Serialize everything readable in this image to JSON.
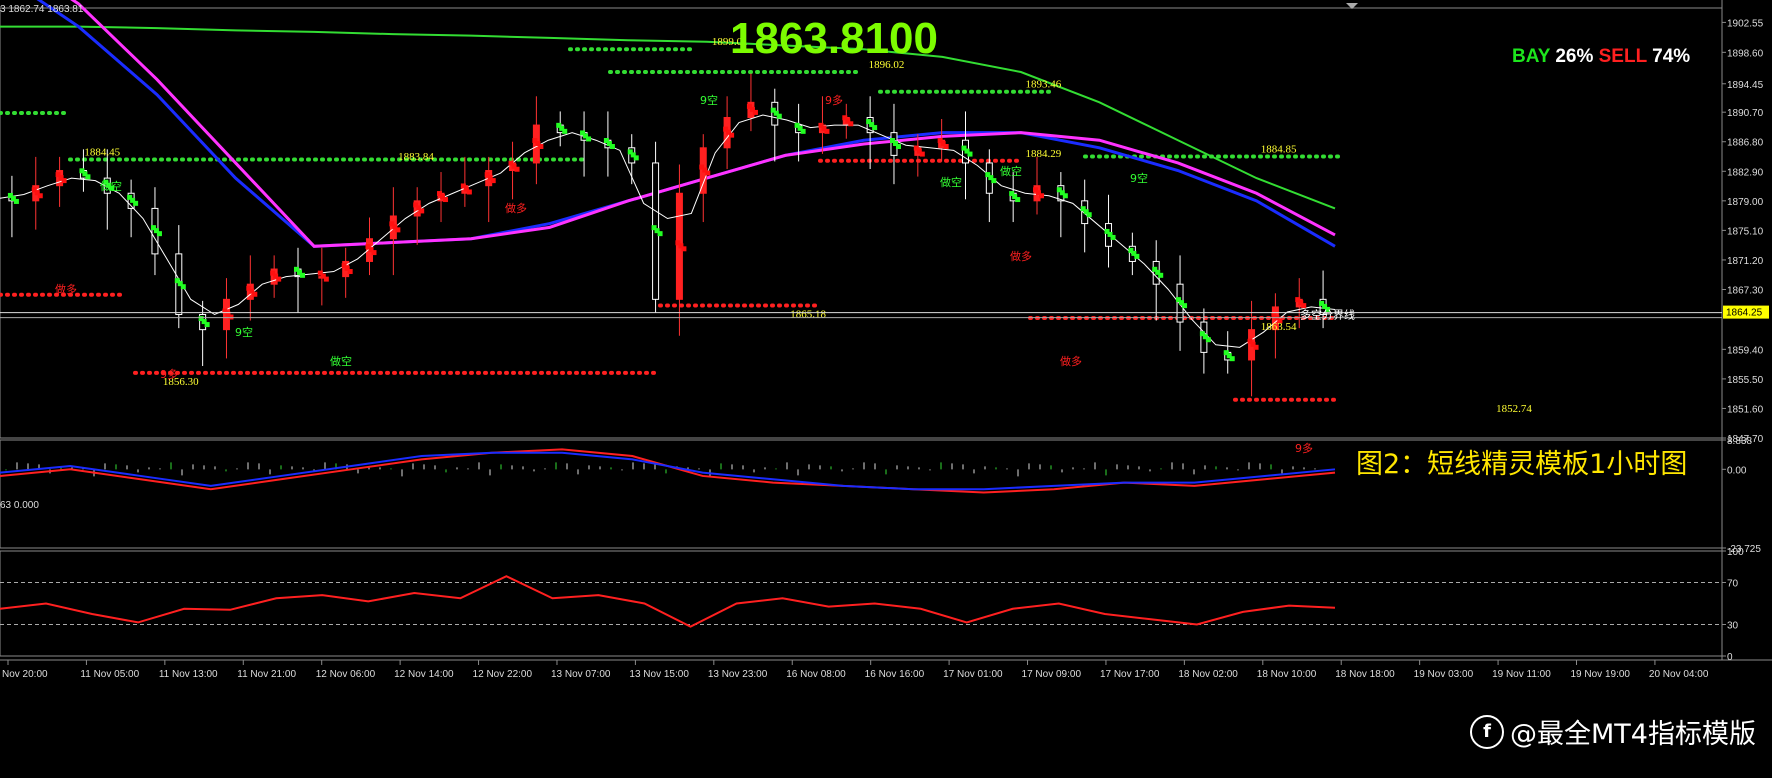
{
  "header": {
    "info": "3 1862.74 1863.81"
  },
  "overlay": {
    "big_price": "1863.8100",
    "bay_label": "BAY",
    "bay_pct": "26%",
    "sell_label": "SELL",
    "sell_pct": "74%",
    "caption": "图2：短线精灵模板1小时图",
    "current_price": "1864.25",
    "divider_label": "多空分界线",
    "sub1_info": "63 0.000",
    "brand": "@最全MT4指标模版",
    "brand_logo": "f"
  },
  "colors": {
    "background": "#000000",
    "up": "#ff0000",
    "down": "#00ff00",
    "ma_blue": "#1a2cff",
    "ma_magenta": "#ff33ff",
    "ma_green": "#33dd33",
    "label_yellow": "#ffff33",
    "grid": "#777777"
  },
  "chart_data": [
    {
      "type": "candlestick",
      "title": "",
      "ylim": [
        1847.7,
        1904.45
      ],
      "price_axis_ticks": [
        "1902.55",
        "1898.60",
        "1894.45",
        "1890.70",
        "1886.80",
        "1882.90",
        "1879.00",
        "1875.10",
        "1871.20",
        "1867.30",
        "1859.40",
        "1855.50",
        "1851.60",
        "1847.70"
      ],
      "x_tick_labels": [
        "Nov 20:00",
        "11 Nov 05:00",
        "11 Nov 13:00",
        "11 Nov 21:00",
        "12 Nov 06:00",
        "12 Nov 14:00",
        "12 Nov 22:00",
        "13 Nov 07:00",
        "13 Nov 15:00",
        "13 Nov 23:00",
        "16 Nov 08:00",
        "16 Nov 16:00",
        "17 Nov 01:00",
        "17 Nov 09:00",
        "17 Nov 17:00",
        "18 Nov 02:00",
        "18 Nov 10:00",
        "18 Nov 18:00",
        "19 Nov 03:00",
        "19 Nov 11:00",
        "19 Nov 19:00",
        "20 Nov 04:00"
      ],
      "close_path": [
        1879.5,
        1879,
        1881,
        1883,
        1882,
        1880,
        1878,
        1872,
        1864,
        1862,
        1866,
        1868,
        1870,
        1869,
        1869,
        1871,
        1874,
        1877,
        1879,
        1880,
        1881,
        1883,
        1884,
        1889,
        1888,
        1887,
        1886,
        1884,
        1866,
        1880,
        1886,
        1890,
        1892,
        1889,
        1888,
        1889,
        1890,
        1888,
        1885,
        1886,
        1887,
        1884,
        1880,
        1879,
        1881,
        1879,
        1876,
        1873,
        1871,
        1868,
        1863,
        1859,
        1858,
        1862,
        1865,
        1866,
        1864
      ],
      "price_labels": [
        {
          "text": "1884.45",
          "x_label": "11 Nov 05:00",
          "y": 1884.45
        },
        {
          "text": "1856.30",
          "x_label": "11 Nov 13:00",
          "y": 1856.3
        },
        {
          "text": "1883.84",
          "x_label": "12 Nov 14:00",
          "y": 1883.84
        },
        {
          "text": "1899.01",
          "x_label": "13 Nov 23:00",
          "y": 1899.01
        },
        {
          "text": "1896.02",
          "x_label": "16 Nov 16:00",
          "y": 1896.02
        },
        {
          "text": "1865.18",
          "x_label": "16 Nov 08:00",
          "y": 1865.18
        },
        {
          "text": "1893.46",
          "x_label": "17 Nov 09:00",
          "y": 1893.46
        },
        {
          "text": "1884.29",
          "x_label": "17 Nov 09:00",
          "y": 1884.29
        },
        {
          "text": "1884.85",
          "x_label": "18 Nov 10:00",
          "y": 1884.85
        },
        {
          "text": "1863.54",
          "x_label": "18 Nov 10:00",
          "y": 1863.54
        },
        {
          "text": "1852.74",
          "x_label": "19 Nov 11:00",
          "y": 1852.74
        }
      ],
      "signal_labels": [
        {
          "text": "做空",
          "color": "#33ff33"
        },
        {
          "text": "做多",
          "color": "#ff2020"
        },
        {
          "text": "9空",
          "color": "#33ff33"
        },
        {
          "text": "9多",
          "color": "#ff2020"
        }
      ],
      "series": [
        {
          "name": "",
          "color": "#33dd33",
          "values": [
            1902,
            1902,
            1901.8,
            1901.5,
            1901.3,
            1901,
            1900.8,
            1900.5,
            1900.2,
            1900,
            1899.5,
            1899,
            1898,
            1896,
            1892,
            1887,
            1882,
            1878
          ]
        },
        {
          "name": "",
          "color": "#1a2cff",
          "values": [
            1909,
            1902,
            1893,
            1882,
            1873,
            1873.5,
            1874,
            1876,
            1879,
            1882,
            1885,
            1887,
            1888,
            1888,
            1886,
            1883,
            1879,
            1873
          ]
        },
        {
          "name": "",
          "color": "#ff33ff",
          "values": [
            1912,
            1905,
            1895,
            1884,
            1873,
            1873.5,
            1874,
            1875.5,
            1879,
            1882,
            1885,
            1886.5,
            1887.5,
            1888,
            1887,
            1884,
            1880,
            1874.5
          ]
        }
      ],
      "support_levels": [
        {
          "color": "#33dd33",
          "y": 1890.6
        },
        {
          "color": "#33dd33",
          "y": 1884.45
        },
        {
          "color": "#33dd33",
          "y": 1899.0
        },
        {
          "color": "#33dd33",
          "y": 1896.0
        },
        {
          "color": "#33dd33",
          "y": 1893.4
        },
        {
          "color": "#33dd33",
          "y": 1884.85
        },
        {
          "color": "#ff2020",
          "y": 1866.6
        },
        {
          "color": "#ff2020",
          "y": 1856.3
        },
        {
          "color": "#ff2020",
          "y": 1865.18
        },
        {
          "color": "#ff2020",
          "y": 1884.29
        },
        {
          "color": "#ff2020",
          "y": 1863.54
        },
        {
          "color": "#ff2020",
          "y": 1852.74
        }
      ],
      "current_price": 1864.25
    },
    {
      "type": "line",
      "title": "",
      "ylim": [
        -23.725,
        8.838
      ],
      "axis_ticks": [
        "8.838",
        "0.00",
        "-23.725"
      ],
      "series": [
        {
          "name": "",
          "color": "#ff2020",
          "values": [
            -2,
            0,
            -3,
            -6,
            -3,
            0,
            3,
            5,
            6,
            4,
            -2,
            -4,
            -5,
            -6,
            -7,
            -6,
            -4,
            -5,
            -3,
            -1
          ]
        },
        {
          "name": "",
          "color": "#1a2cff",
          "values": [
            -1,
            1,
            -2,
            -5,
            -2,
            1,
            4,
            5,
            5,
            3,
            -1,
            -3,
            -5,
            -6,
            -6,
            -5,
            -4,
            -4,
            -2,
            0
          ]
        }
      ]
    },
    {
      "type": "line",
      "title": "",
      "ylim": [
        0,
        100
      ],
      "axis_ticks": [
        "100",
        "70",
        "30",
        "0"
      ],
      "reference_lines": [
        70,
        30
      ],
      "series": [
        {
          "name": "",
          "color": "#ff2020",
          "values": [
            45,
            50,
            40,
            32,
            45,
            44,
            55,
            58,
            52,
            60,
            55,
            76,
            55,
            58,
            50,
            28,
            50,
            55,
            47,
            50,
            45,
            32,
            45,
            50,
            40,
            35,
            30,
            42,
            48,
            46
          ]
        }
      ]
    }
  ]
}
